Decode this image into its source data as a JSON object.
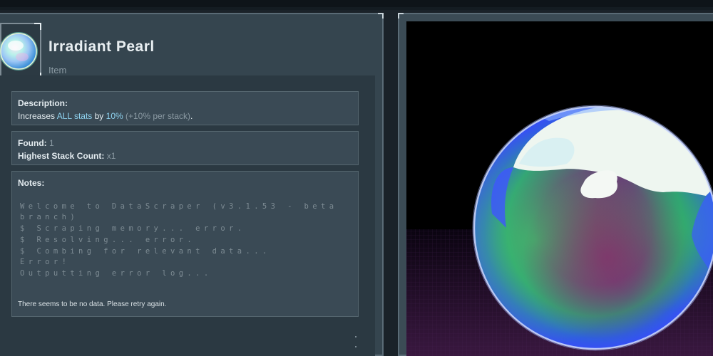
{
  "item": {
    "name": "Irradiant Pearl",
    "category": "Item"
  },
  "description": {
    "label": "Description:",
    "prefix": "Increases ",
    "stat": "ALL stats",
    "by": " by ",
    "amount": "10%",
    "stack": " (+10% per stack)",
    "end": "."
  },
  "stats": {
    "found_label": "Found:",
    "found_value": "1",
    "stack_label": "Highest Stack Count:",
    "stack_value": "x1"
  },
  "notes": {
    "label": "Notes:",
    "log": [
      "Welcome to DataScraper (v3.1.53 - beta",
      "branch)",
      "$ Scraping memory... error.",
      "$ Resolving... error.",
      "$ Combing for relevant data...",
      "Error!",
      "Outputting error log..."
    ],
    "footer": "There seems to be no data. Please retry again."
  },
  "colors": {
    "accent": "#8fd3f0",
    "panel": "#35454f",
    "text": "#e4ecf0"
  },
  "icons": [
    "pearl-icon",
    "pearl-3d-model"
  ]
}
